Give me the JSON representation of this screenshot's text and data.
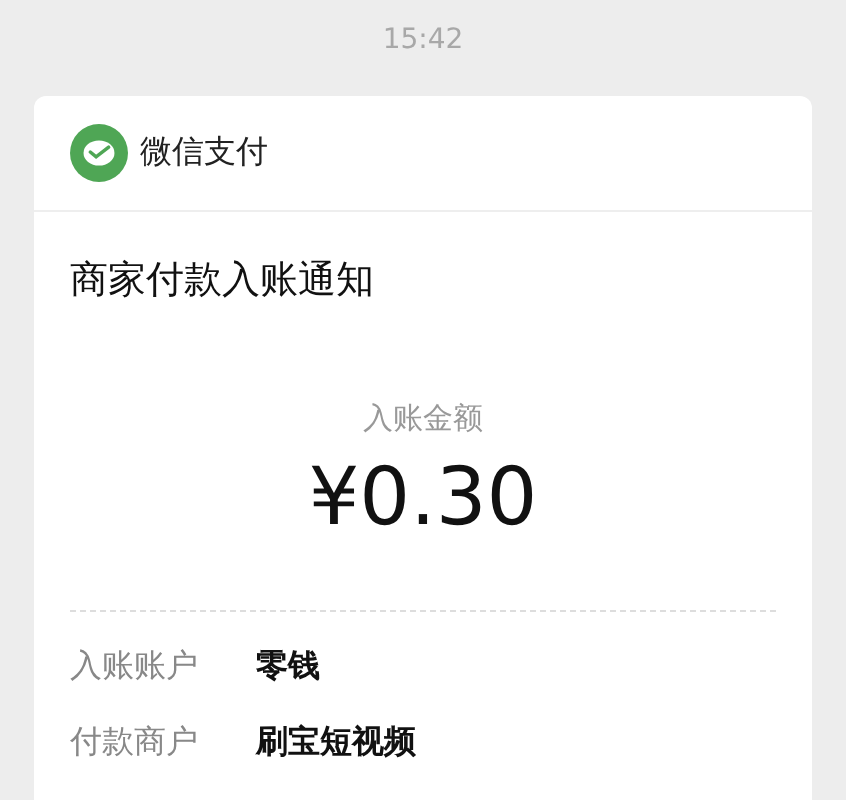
{
  "time": "15:42",
  "card": {
    "app_name": "微信支付",
    "title": "商家付款入账通知",
    "amount_label": "入账金额",
    "amount": "¥0.30",
    "rows": [
      {
        "label": "入账账户",
        "value": "零钱"
      },
      {
        "label": "付款商户",
        "value": "刷宝短视频"
      }
    ]
  }
}
